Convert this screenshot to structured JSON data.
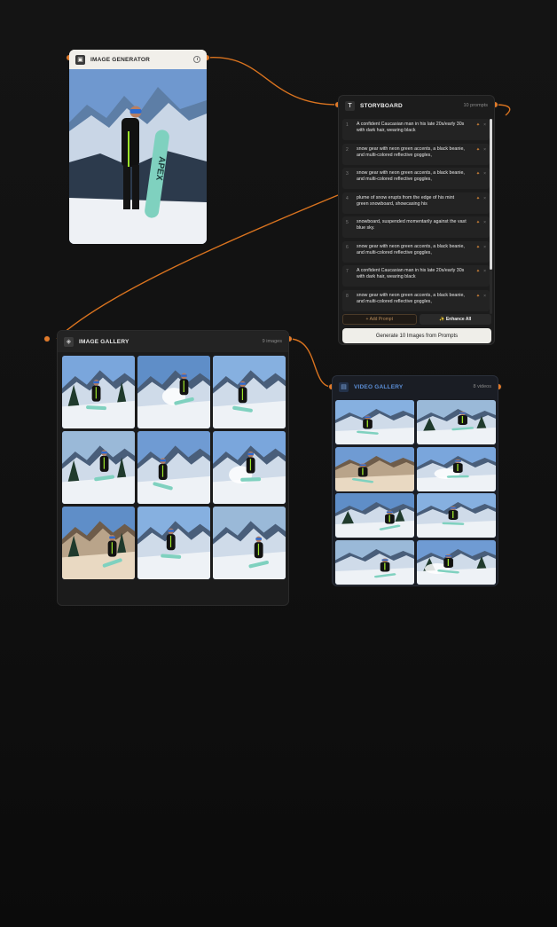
{
  "image_generator": {
    "title": "IMAGE GENERATOR",
    "icon": "image-generator-icon",
    "board_text": "APEX"
  },
  "storyboard": {
    "title": "STORYBOARD",
    "icon": "T",
    "count": "10 prompts",
    "prompts": [
      {
        "num": "1",
        "text": "A confident Caucasian man in his late 20s/early 30s with dark hair, wearing black"
      },
      {
        "num": "2",
        "text": "snow gear with neon green accents, a black beanie, and multi-colored reflective goggles,"
      },
      {
        "num": "3",
        "text": "snow gear with neon green accents, a black beanie, and multi-colored reflective goggles,"
      },
      {
        "num": "4",
        "text": "plume of snow erupts from the edge of his mint green snowboard, showcasing his"
      },
      {
        "num": "5",
        "text": "snowboard, suspended momentarily against the vast blue sky."
      },
      {
        "num": "6",
        "text": "snow gear with neon green accents, a black beanie, and multi-colored reflective goggles,"
      },
      {
        "num": "7",
        "text": "A confident Caucasian man in his late 20s/early 30s with dark hair, wearing black"
      },
      {
        "num": "8",
        "text": "snow gear with neon green accents, a black beanie, and multi-colored reflective goggles,"
      }
    ],
    "add_prompt_label": "+ Add Prompt",
    "enhance_all_label": "✨ Enhance All",
    "generate_label": "Generate 10 Images from Prompts"
  },
  "image_gallery": {
    "title": "IMAGE GALLERY",
    "count": "9 images"
  },
  "video_gallery": {
    "title": "VIDEO GALLERY",
    "count": "8 videos"
  },
  "colors": {
    "wire": "#d9731f",
    "accent_blue": "#5b8ed6",
    "generate_button": "#efeee9"
  }
}
